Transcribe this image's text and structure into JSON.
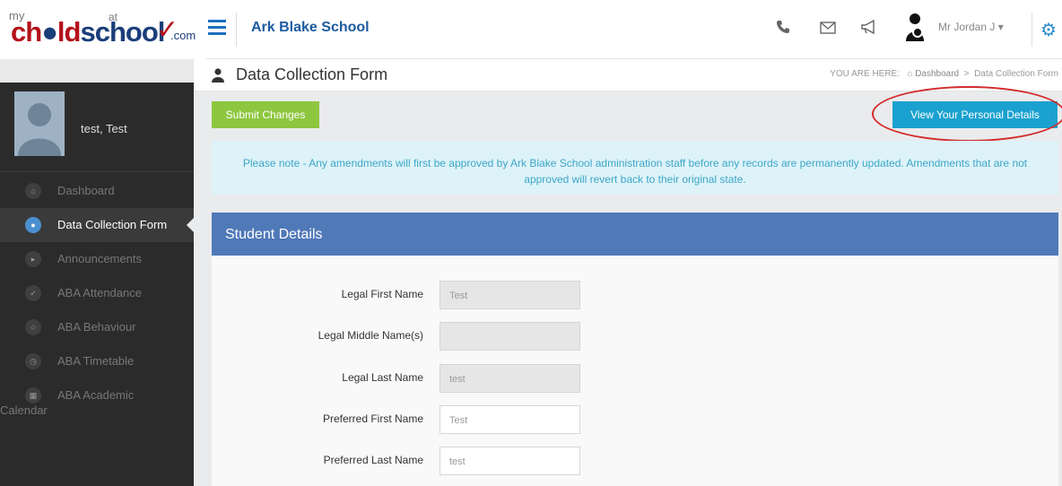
{
  "header": {
    "logo": {
      "my": "my",
      "brand_a": "ch",
      "brand_b": "ld",
      "brand_c": "school",
      "at": "at",
      "com": ".com"
    },
    "school_name": "Ark Blake School",
    "user_name": "Mr Jordan J",
    "icons": [
      "menu-icon",
      "phone-icon",
      "envelope-icon",
      "megaphone-icon",
      "parent-child-icon",
      "gear-icon"
    ]
  },
  "page": {
    "title": "Data Collection Form",
    "breadcrumb": {
      "prefix": "YOU ARE HERE:",
      "home": "Dashboard",
      "separator": ">",
      "current": "Data Collection Form"
    }
  },
  "sidebar": {
    "profile_name": "test, Test",
    "items": [
      {
        "label": "Dashboard",
        "icon": "home-icon"
      },
      {
        "label": "Data Collection Form",
        "icon": "user-icon",
        "active": true
      },
      {
        "label": "Announcements",
        "icon": "megaphone-icon"
      },
      {
        "label": "ABA Attendance",
        "icon": "check-icon"
      },
      {
        "label": "ABA Behaviour",
        "icon": "star-icon"
      },
      {
        "label": "ABA Timetable",
        "icon": "clock-icon"
      },
      {
        "label": "ABA Academic",
        "label2": "Calendar",
        "icon": "calendar-icon"
      }
    ]
  },
  "actions": {
    "submit": "Submit Changes",
    "view_details": "View Your Personal Details"
  },
  "notice": "Please note - Any amendments will first be approved by Ark Blake School administration staff before any records are permanently updated. Amendments that are not approved will revert back to their original state.",
  "panel": {
    "title": "Student Details",
    "fields": [
      {
        "label": "Legal First Name",
        "value": "Test",
        "disabled": true
      },
      {
        "label": "Legal Middle Name(s)",
        "value": "",
        "disabled": true
      },
      {
        "label": "Legal Last Name",
        "value": "test",
        "disabled": true
      },
      {
        "label": "Preferred First Name",
        "value": "Test",
        "disabled": false
      },
      {
        "label": "Preferred Last Name",
        "value": "test",
        "disabled": false
      }
    ]
  },
  "colors": {
    "brand_red": "#b5121b",
    "brand_blue": "#1a3e7a",
    "submit_green": "#8dc63f",
    "view_blue": "#1ba1cf",
    "panel_blue": "#5079b8",
    "notice_bg": "#ddf3f9",
    "annotation_red": "#d32a2a"
  }
}
